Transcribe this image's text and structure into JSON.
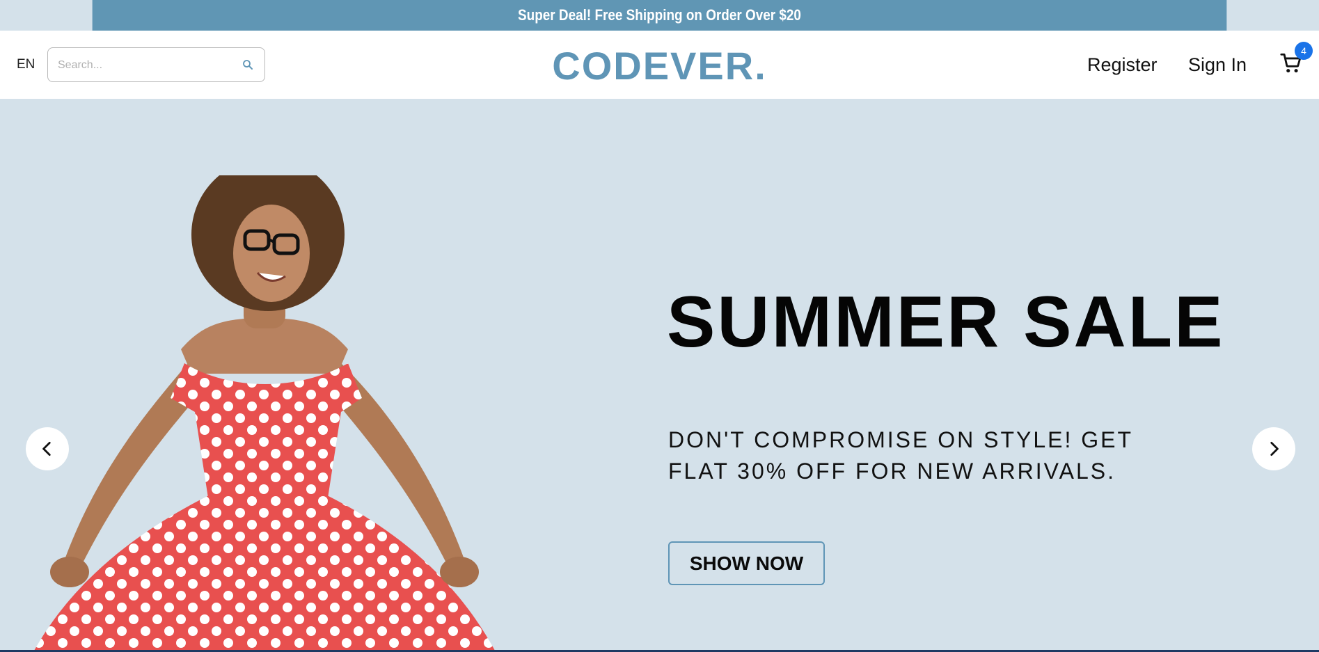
{
  "announcement": {
    "text": "Super Deal! Free Shipping on Order Over $20"
  },
  "navbar": {
    "language": "EN",
    "search": {
      "placeholder": "Search...",
      "value": ""
    },
    "logo": "CODEVER.",
    "links": {
      "register": "Register",
      "sign_in": "Sign In"
    },
    "cart": {
      "icon": "shopping-cart-icon",
      "count": "4"
    }
  },
  "hero": {
    "title": "SUMMER SALE",
    "description": "DON'T COMPROMISE ON STYLE! GET FLAT 30% OFF FOR NEW ARRIVALS.",
    "button_label": "SHOW NOW",
    "prev_icon": "chevron-left-icon",
    "next_icon": "chevron-right-icon"
  },
  "colors": {
    "accent": "#6096b4",
    "hero_bg": "#d4e1ea",
    "badge": "#1a73e8",
    "dress": "#e8504f"
  }
}
